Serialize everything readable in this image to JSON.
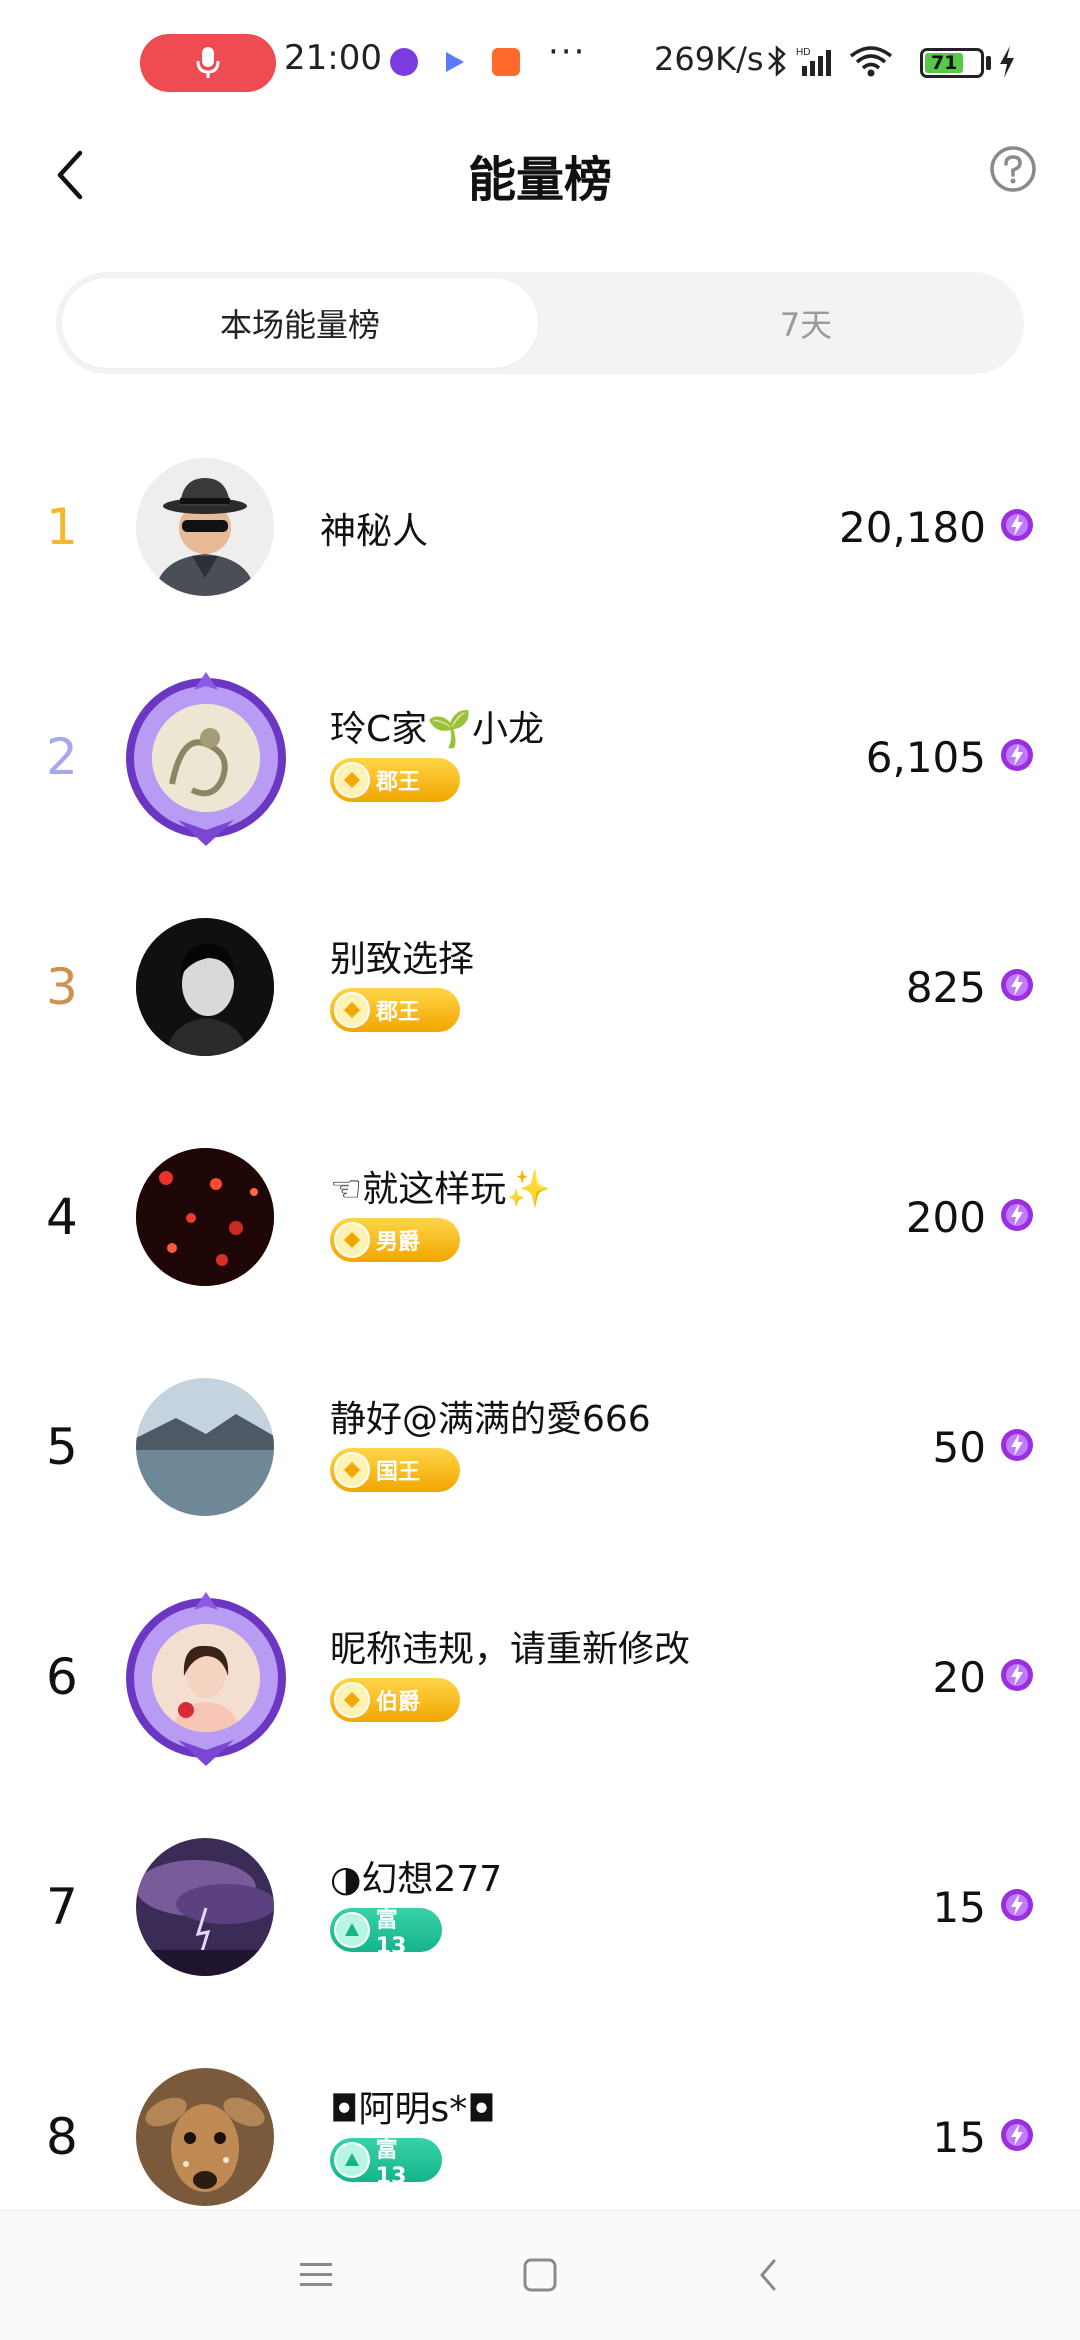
{
  "status_bar": {
    "time": "21:00",
    "dots": "···",
    "net_speed": "269K/s",
    "battery": "71"
  },
  "header": {
    "title": "能量榜",
    "back_icon": "chevron-left-icon",
    "help_icon": "question-circle-icon"
  },
  "tabs": [
    {
      "label": "本场能量榜",
      "active": true
    },
    {
      "label": "7天",
      "active": false
    }
  ],
  "ranking": [
    {
      "rank": "1",
      "name": "神秘人",
      "score": "20,180",
      "badge": null,
      "rank_color": "#f5b72a"
    },
    {
      "rank": "2",
      "name": "玲C家🌱小龙",
      "score": "6,105",
      "badge": "郡王",
      "rank_color": "#a8a7f0"
    },
    {
      "rank": "3",
      "name": "别致选择",
      "score": "825",
      "badge": "郡王",
      "rank_color": "#d2904f"
    },
    {
      "rank": "4",
      "name": "☜就这样玩✨",
      "score": "200",
      "badge": "男爵",
      "rank_color": "#111111"
    },
    {
      "rank": "5",
      "name": "静好@满满的愛666",
      "score": "50",
      "badge": "国王",
      "rank_color": "#111111"
    },
    {
      "rank": "6",
      "name": "昵称违规，请重新修改",
      "score": "20",
      "badge": "伯爵",
      "rank_color": "#111111"
    },
    {
      "rank": "7",
      "name": "◑幻想277",
      "score": "15",
      "badge": "富13",
      "rank_color": "#111111"
    },
    {
      "rank": "8",
      "name": "◘阿明s*◘",
      "score": "15",
      "badge": "富13",
      "rank_color": "#111111"
    }
  ],
  "colors": {
    "accent_purple": "#9b2fe0",
    "badge_gold": "#f2a600",
    "badge_green": "#15b48b",
    "record_red": "#ef4b53"
  }
}
